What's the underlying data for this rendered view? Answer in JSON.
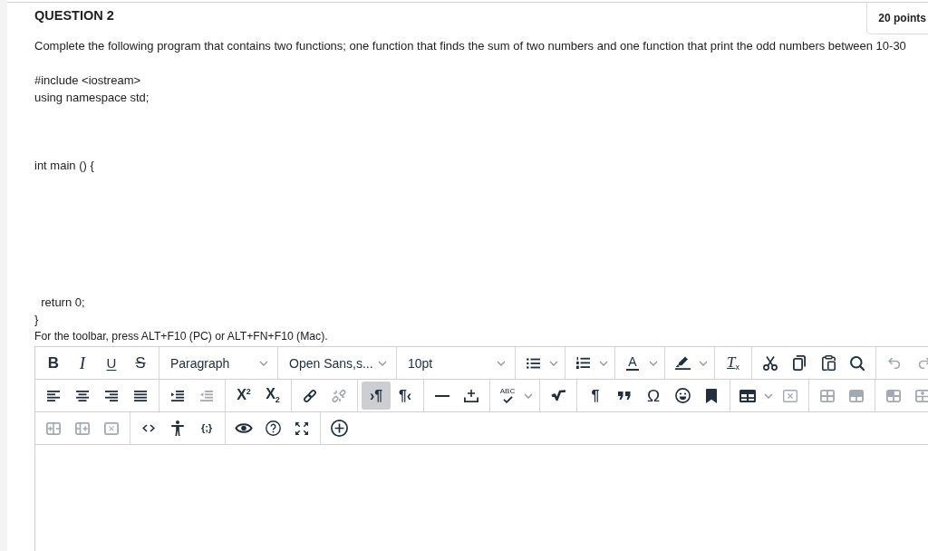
{
  "question": {
    "title": "QUESTION 2",
    "points": "20 points",
    "prompt": "Complete the following program that contains two functions; one function that finds the sum of two numbers and one function that print the odd numbers between 10-30"
  },
  "code": [
    {
      "lines": [
        "#include <iostream>",
        "using namespace std;"
      ]
    },
    {
      "lines": [
        "int main () {"
      ]
    },
    {
      "lines": [
        "  return 0;",
        "}"
      ]
    }
  ],
  "editor": {
    "toolbar_hint": "For the toolbar, press ALT+F10 (PC) or ALT+FN+F10 (Mac).",
    "toolbar": [
      {
        "groups": [
          {
            "items": [
              {
                "kind": "bold",
                "label": "B",
                "disabled": false,
                "selected": false
              },
              {
                "kind": "italic",
                "label": "I",
                "disabled": false,
                "selected": false
              },
              {
                "kind": "underline",
                "label": "U",
                "disabled": false,
                "selected": false
              },
              {
                "kind": "strikethrough",
                "label": "S",
                "disabled": false,
                "selected": false
              }
            ]
          },
          {
            "items": [
              {
                "kind": "blocks",
                "value": "Paragraph"
              }
            ]
          },
          {
            "items": [
              {
                "kind": "fontfamily",
                "value": "Open Sans,s..."
              }
            ]
          },
          {
            "items": [
              {
                "kind": "fontsize",
                "value": "10pt"
              }
            ]
          },
          {
            "items": [
              {
                "kind": "bullist",
                "disabled": false,
                "selected": false
              }
            ]
          },
          {
            "items": [
              {
                "kind": "numlist",
                "disabled": false,
                "selected": false
              }
            ]
          },
          {
            "items": [
              {
                "kind": "forecolor",
                "label": "A",
                "disabled": false,
                "selected": false
              }
            ]
          },
          {
            "items": [
              {
                "kind": "hilitecolor",
                "disabled": false,
                "selected": false
              }
            ]
          },
          {
            "items": [
              {
                "kind": "removeformat",
                "label": "T$_{x}$",
                "disabled": false,
                "selected": false
              }
            ]
          },
          {
            "items": [
              {
                "kind": "cut",
                "disabled": false,
                "selected": false
              },
              {
                "kind": "copy",
                "disabled": false,
                "selected": false
              },
              {
                "kind": "paste",
                "disabled": false,
                "selected": false
              },
              {
                "kind": "search",
                "disabled": false,
                "selected": false
              }
            ]
          },
          {
            "items": [
              {
                "kind": "undo",
                "disabled": true,
                "selected": false
              },
              {
                "kind": "redo",
                "disabled": true,
                "selected": false
              }
            ]
          }
        ]
      },
      {
        "groups": [
          {
            "items": [
              {
                "kind": "alignleft",
                "disabled": false,
                "selected": false
              },
              {
                "kind": "aligncenter",
                "disabled": false,
                "selected": false
              },
              {
                "kind": "alignright",
                "disabled": false,
                "selected": false
              },
              {
                "kind": "alignjustify",
                "disabled": false,
                "selected": false
              }
            ]
          },
          {
            "items": [
              {
                "kind": "indent",
                "disabled": false,
                "selected": false
              },
              {
                "kind": "outdent",
                "disabled": true,
                "selected": false
              }
            ]
          },
          {
            "items": [
              {
                "kind": "superscript",
                "label": "X$^{2}$",
                "disabled": false,
                "selected": false
              },
              {
                "kind": "subscript",
                "label": "X$_{2}$",
                "disabled": false,
                "selected": false
              }
            ]
          },
          {
            "items": [
              {
                "kind": "link",
                "disabled": false,
                "selected": false
              },
              {
                "kind": "unlink",
                "disabled": true,
                "selected": false
              }
            ]
          },
          {
            "items": [
              {
                "kind": "ltr",
                "label": "›¶",
                "disabled": false,
                "selected": true
              },
              {
                "kind": "rtl",
                "label": "¶‹",
                "disabled": false,
                "selected": false
              }
            ]
          },
          {
            "items": [
              {
                "kind": "hr",
                "disabled": false,
                "selected": false
              },
              {
                "kind": "insert",
                "disabled": false,
                "selected": false
              }
            ]
          },
          {
            "items": [
              {
                "kind": "spellcheck",
                "label": "ABC",
                "disabled": false,
                "selected": false
              }
            ]
          },
          {
            "items": [
              {
                "kind": "math",
                "disabled": false,
                "selected": false
              }
            ]
          },
          {
            "items": [
              {
                "kind": "pilcrow",
                "label": "¶",
                "disabled": false,
                "selected": false
              },
              {
                "kind": "blockquote",
                "disabled": false,
                "selected": false
              },
              {
                "kind": "charmap",
                "label": "Ω",
                "disabled": false,
                "selected": false
              },
              {
                "kind": "emoji",
                "disabled": false,
                "selected": false
              },
              {
                "kind": "bookmark",
                "disabled": false,
                "selected": false
              }
            ]
          },
          {
            "items": [
              {
                "kind": "table",
                "disabled": false,
                "selected": false
              },
              {
                "kind": "tabledelete",
                "disabled": true,
                "selected": false
              }
            ]
          },
          {
            "items": [
              {
                "kind": "tablegrid",
                "disabled": true,
                "selected": false
              },
              {
                "kind": "tablerow",
                "disabled": true,
                "selected": false
              }
            ]
          },
          {
            "items": [
              {
                "kind": "tablecell",
                "disabled": true,
                "selected": false
              },
              {
                "kind": "tableplus",
                "disabled": true,
                "selected": false
              }
            ]
          }
        ]
      },
      {
        "groups": [
          {
            "items": [
              {
                "kind": "tableplusleft",
                "disabled": true,
                "selected": false
              },
              {
                "kind": "tableplusright",
                "disabled": true,
                "selected": false
              },
              {
                "kind": "tablex",
                "disabled": true,
                "selected": false
              }
            ]
          },
          {
            "items": [
              {
                "kind": "code",
                "disabled": false,
                "selected": false
              },
              {
                "kind": "accessibility",
                "disabled": false,
                "selected": false
              },
              {
                "kind": "codesample",
                "label": "{;}",
                "disabled": false,
                "selected": false
              }
            ]
          },
          {
            "items": [
              {
                "kind": "preview",
                "disabled": false,
                "selected": false
              },
              {
                "kind": "help",
                "disabled": false,
                "selected": false
              },
              {
                "kind": "fullscreen",
                "disabled": false,
                "selected": false
              }
            ]
          },
          {
            "items": [
              {
                "kind": "add",
                "disabled": false,
                "selected": false
              }
            ]
          }
        ]
      }
    ]
  }
}
